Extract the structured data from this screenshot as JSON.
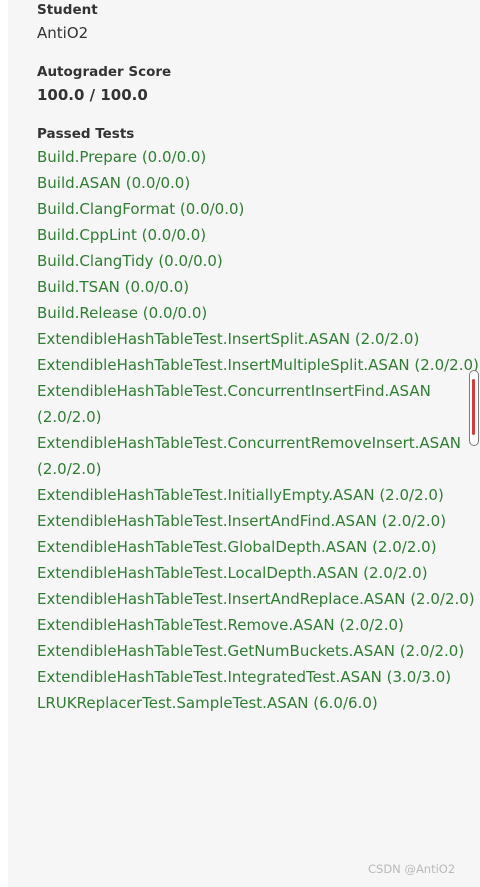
{
  "student": {
    "label": "Student",
    "value": "AntiO2"
  },
  "score": {
    "label": "Autograder Score",
    "value": "100.0 / 100.0"
  },
  "passed_tests": {
    "label": "Passed Tests",
    "items": [
      "Build.Prepare (0.0/0.0)",
      "Build.ASAN (0.0/0.0)",
      "Build.ClangFormat (0.0/0.0)",
      "Build.CppLint (0.0/0.0)",
      "Build.ClangTidy (0.0/0.0)",
      "Build.TSAN (0.0/0.0)",
      "Build.Release (0.0/0.0)",
      "ExtendibleHashTableTest.InsertSplit.ASAN (2.0/2.0)",
      "ExtendibleHashTableTest.InsertMultipleSplit.ASAN (2.0/2.0)",
      "ExtendibleHashTableTest.ConcurrentInsertFind.ASAN (2.0/2.0)",
      "ExtendibleHashTableTest.ConcurrentRemoveInsert.ASAN (2.0/2.0)",
      "ExtendibleHashTableTest.InitiallyEmpty.ASAN (2.0/2.0)",
      "ExtendibleHashTableTest.InsertAndFind.ASAN (2.0/2.0)",
      "ExtendibleHashTableTest.GlobalDepth.ASAN (2.0/2.0)",
      "ExtendibleHashTableTest.LocalDepth.ASAN (2.0/2.0)",
      "ExtendibleHashTableTest.InsertAndReplace.ASAN (2.0/2.0)",
      "ExtendibleHashTableTest.Remove.ASAN (2.0/2.0)",
      "ExtendibleHashTableTest.GetNumBuckets.ASAN (2.0/2.0)",
      "ExtendibleHashTableTest.IntegratedTest.ASAN (3.0/3.0)",
      "LRUKReplacerTest.SampleTest.ASAN (6.0/6.0)"
    ]
  },
  "watermark": "CSDN @AntiO2",
  "colors": {
    "passed": "#2e7d32",
    "panel_bg": "#f6f6f6",
    "text": "#333333"
  }
}
